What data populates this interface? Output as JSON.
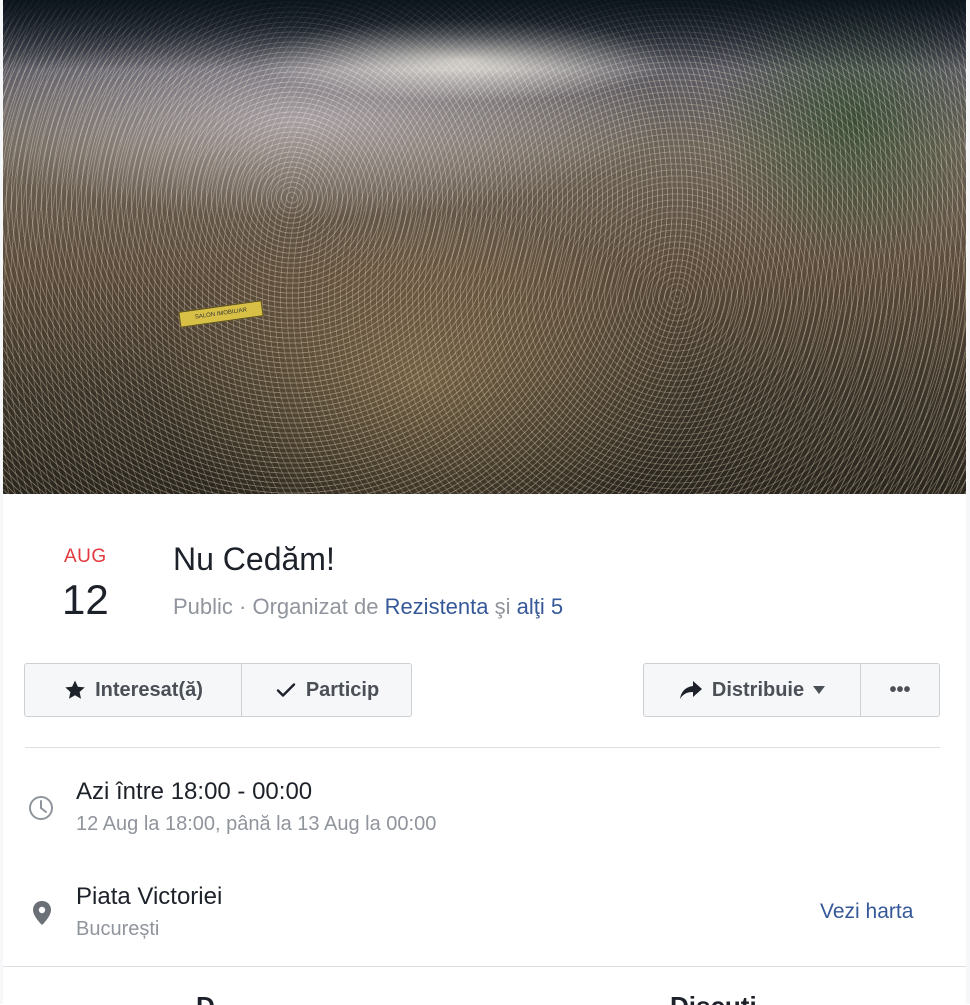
{
  "event": {
    "month": "AUG",
    "day": "12",
    "title": "Nu Cedăm!",
    "privacy": "Public",
    "organized_by_prefix": " · Organizat de ",
    "organizer": "Rezistenta",
    "and_text": " şi ",
    "others": "alţi 5",
    "cover_banner_text": "SALON IMOBILIAR"
  },
  "actions": {
    "interested_label": "Interesat(ă)",
    "going_label": "Particip",
    "share_label": "Distribuie",
    "more_label": "•••"
  },
  "details": {
    "time_main": "Azi între 18:00 - 00:00",
    "time_sub": "12 Aug la 18:00, până la 13 Aug la 00:00",
    "place_main": "Piata Victoriei",
    "place_sub": "București",
    "map_link": "Vezi harta"
  },
  "bottom_tabs": {
    "left": "D",
    "right": "Discuti"
  },
  "colors": {
    "accent_red": "#e0393e",
    "link_blue": "#365899",
    "muted_gray": "#90949c"
  }
}
